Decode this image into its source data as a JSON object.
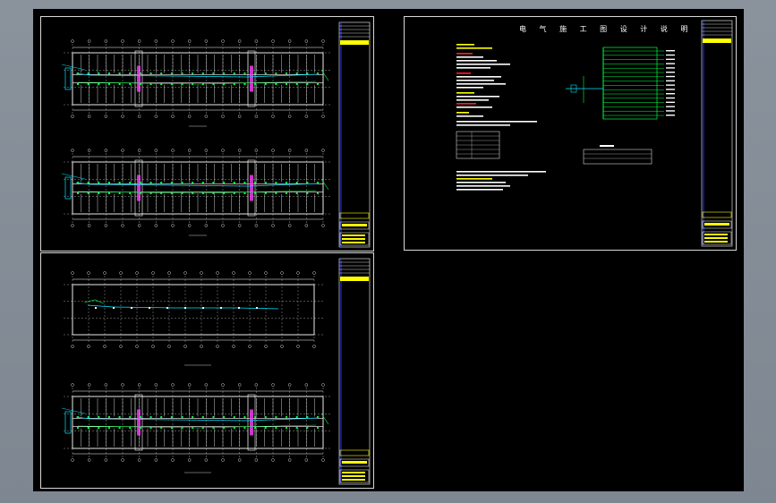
{
  "viewer": {
    "background": "#000000",
    "line_color": "#ffffff",
    "accent_cyan": "#00e5ff",
    "accent_green": "#00ff40",
    "accent_yellow": "#ffff00",
    "accent_magenta": "#ff40ff",
    "accent_red": "#ff2020",
    "accent_blue": "#2030ff"
  },
  "design_notes_sheet": {
    "title": "电 气 施 工 图 设 计 说 明"
  }
}
